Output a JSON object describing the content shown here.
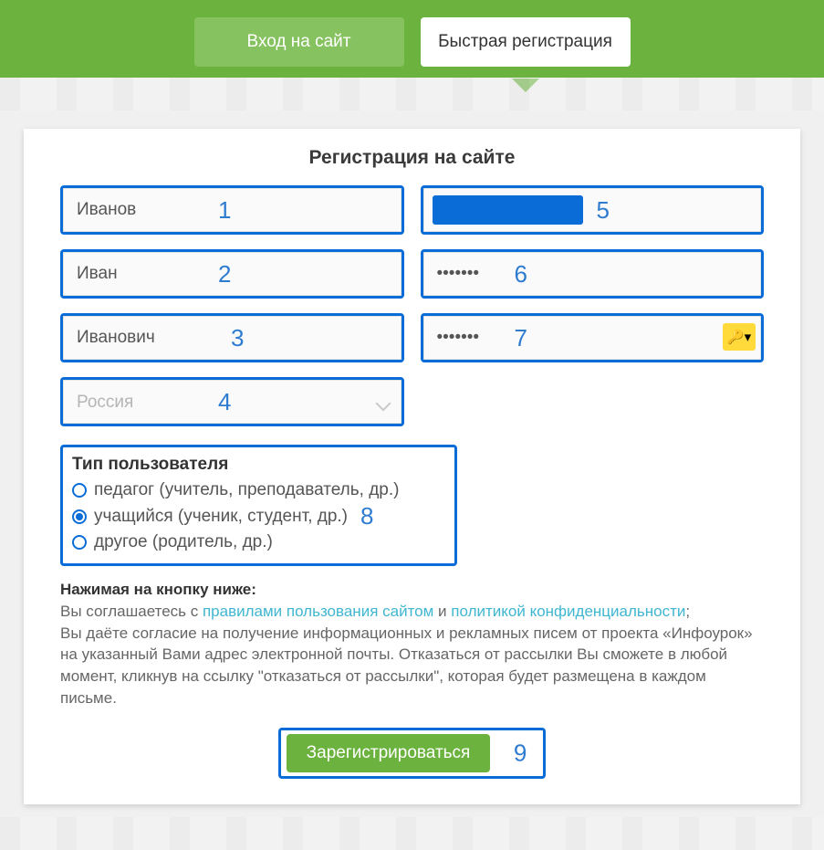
{
  "tabs": {
    "login": "Вход на сайт",
    "register": "Быстрая регистрация"
  },
  "form": {
    "title": "Регистрация на сайте",
    "surname": {
      "value": "Иванов",
      "step": "1"
    },
    "name": {
      "value": "Иван",
      "step": "2"
    },
    "patronymic": {
      "value": "Иванович",
      "step": "3"
    },
    "country": {
      "value": "Россия",
      "step": "4"
    },
    "email": {
      "step": "5"
    },
    "password": {
      "value": "•••••••",
      "step": "6"
    },
    "password_confirm": {
      "value": "•••••••",
      "step": "7",
      "key_icon": "🔑▾"
    },
    "user_type": {
      "title": "Тип пользователя",
      "step": "8",
      "options": [
        "педагог (учитель, преподаватель, др.)",
        "учащийся (ученик, студент, др.)",
        "другое (родитель, др.)"
      ],
      "selected_index": 1
    },
    "terms": {
      "lead": "Нажимая на кнопку ниже:",
      "line1_pre": "Вы соглашаетесь с ",
      "link_rules": "правилами пользования сайтом",
      "mid": " и ",
      "link_privacy": "политикой конфиденциальности",
      "line1_post": ";",
      "line2": "Вы даёте согласие на получение информационных и рекламных писем от проекта «Инфоурок» на указанный Вами адрес электронной почты. Отказаться от рассылки Вы сможете в любой момент, кликнув на ссылку \"отказаться от рассылки\", которая будет размещена в каждом письме."
    },
    "submit": {
      "label": "Зарегистрироваться",
      "step": "9"
    }
  }
}
